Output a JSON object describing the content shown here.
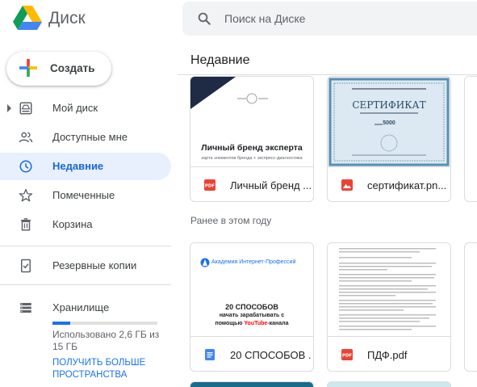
{
  "header": {
    "app_name": "Диск",
    "search_placeholder": "Поиск на Диске"
  },
  "sidebar": {
    "create_label": "Создать",
    "items": [
      {
        "label": "Мой диск",
        "icon": "drive-icon",
        "active": false
      },
      {
        "label": "Доступные мне",
        "icon": "shared-people-icon",
        "active": false
      },
      {
        "label": "Недавние",
        "icon": "clock-icon",
        "active": true
      },
      {
        "label": "Помеченные",
        "icon": "star-icon",
        "active": false
      },
      {
        "label": "Корзина",
        "icon": "trash-icon",
        "active": false
      },
      {
        "label": "Резервные копии",
        "icon": "backup-icon",
        "active": false
      },
      {
        "label": "Хранилище",
        "icon": "storage-icon",
        "active": false
      }
    ],
    "storage": {
      "used_text": "Использовано 2,6 ГБ из 15 ГБ",
      "used_fraction": 0.17,
      "upgrade_link": "ПОЛУЧИТЬ БОЛЬШЕ ПРОСТРАНСТВА"
    }
  },
  "main": {
    "section_title": "Недавние",
    "section_earlier": "Ранее в этом году",
    "files": [
      {
        "name": "Личный бренд ...",
        "type": "pdf",
        "thumb_title": "Личный бренд эксперта",
        "thumb_subtitle": "карта элементов бренда + экспресс-диагностика"
      },
      {
        "name": "сертификат.pn...",
        "type": "image",
        "thumb_title": "СЕРТИФИКАТ",
        "thumb_amount": "5000"
      },
      {
        "name": "20 СПОСОБОВ ...",
        "type": "doc",
        "thumb_brand": "Академия Интернет-Профессий",
        "thumb_line1": "20 СПОСОБОВ",
        "thumb_line2": "начать зарабатывать с",
        "thumb_line3a": "помощью ",
        "thumb_line3b": "YouTube",
        "thumb_line3c": "-канала"
      },
      {
        "name": "ПДФ.pdf",
        "type": "pdf"
      }
    ]
  },
  "colors": {
    "accent": "#1a73e8",
    "active_bg": "#e8f0fe",
    "pdf_red": "#ea4335",
    "doc_blue": "#4285f4",
    "youtube_red": "#ff0000"
  }
}
